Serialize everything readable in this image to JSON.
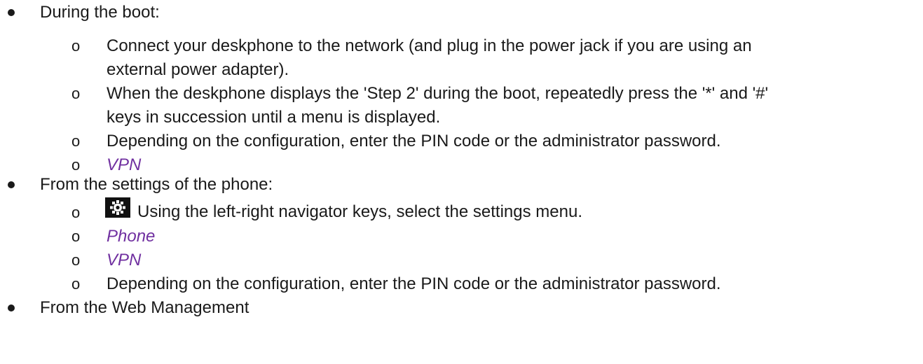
{
  "items": [
    {
      "label": "During the boot:",
      "subitems": [
        {
          "line1": "Connect your deskphone to the network (and plug in the power jack if you are using an",
          "line2": "external power adapter)."
        },
        {
          "line1": "When the deskphone displays the 'Step 2' during the boot, repeatedly press the '*' and '#'",
          "line2": "keys in succession until a menu is displayed."
        },
        {
          "text": "Depending on the configuration, enter the PIN code or the administrator password."
        },
        {
          "text": "VPN",
          "style": "italic-link"
        }
      ]
    },
    {
      "label": "From the settings of the phone:",
      "subitems": [
        {
          "icon": "gear-icon",
          "text": "Using the left-right navigator keys, select the settings menu."
        },
        {
          "text": "Phone",
          "style": "italic-link"
        },
        {
          "text": "VPN",
          "style": "italic-link"
        },
        {
          "text": "Depending on the configuration, enter the PIN code or the administrator password."
        }
      ]
    },
    {
      "label": "From the Web Management"
    }
  ],
  "sub_marker": "o",
  "colors": {
    "text": "#1a1a1a",
    "link": "#7030a0"
  }
}
